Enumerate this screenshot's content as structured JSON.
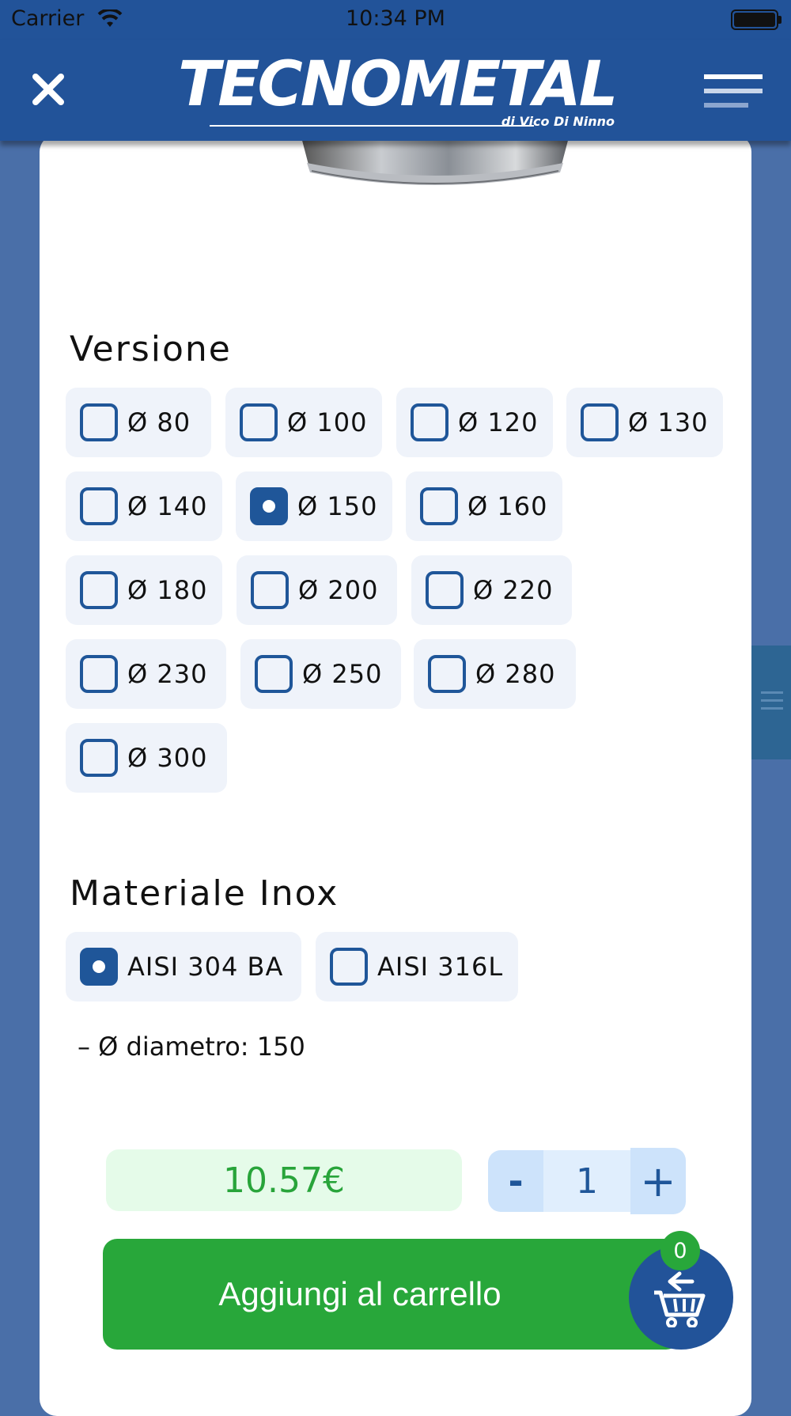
{
  "status_bar": {
    "carrier": "Carrier",
    "time": "10:34 PM"
  },
  "header": {
    "logo_text": "TECNOMETAL",
    "logo_subtext": "di Vico Di Ninno"
  },
  "versione": {
    "title": "Versione",
    "options": [
      "Ø 80",
      "Ø 100",
      "Ø 120",
      "Ø 130",
      "Ø 140",
      "Ø 150",
      "Ø 160",
      "Ø 180",
      "Ø 200",
      "Ø 220",
      "Ø 230",
      "Ø 250",
      "Ø 280",
      "Ø 300"
    ],
    "selected": "Ø 150"
  },
  "materiale": {
    "title": "Materiale Inox",
    "options": [
      "AISI 304 BA",
      "AISI 316L"
    ],
    "selected": "AISI 304 BA"
  },
  "summary": "– Ø diametro: 150",
  "price": "10.57€",
  "quantity": {
    "minus_label": "-",
    "value": "1",
    "plus_label": "+"
  },
  "add_to_cart": "Aggiungi al carrello",
  "cart_count": "0",
  "colors": {
    "brand_blue": "#225399",
    "green": "#28a73a",
    "price_bg": "#e5fbe9"
  },
  "icons": [
    "wifi-icon",
    "battery-icon",
    "close-icon",
    "hamburger-menu-icon",
    "cart-icon"
  ]
}
